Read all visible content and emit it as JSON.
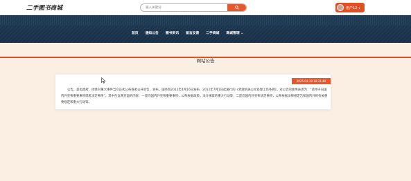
{
  "header": {
    "logo": "二手图书商城",
    "search": {
      "placeholder": "输入关键词"
    },
    "user": {
      "label": "用户12",
      "caret": "▾"
    }
  },
  "nav": {
    "items": [
      {
        "label": "首页"
      },
      {
        "label": "通知公告"
      },
      {
        "label": "图书资讯"
      },
      {
        "label": "留言反馈"
      },
      {
        "label": "二手商城"
      },
      {
        "label": "商城管理 ⌄"
      }
    ]
  },
  "page": {
    "title": "网站公告"
  },
  "notice": {
    "date": "2025-04-30 18:21:40",
    "text": "公告。是指政府、团体对重大事件当众正式公布或者公开宣告，宣布。国务院2012年4月16日发布、2012年7月1日起施行的《党政机关公文处理工作条例》，对公告的使用表述为：“适用于向国内外宣布重要事项或者法定事项”。其中包含两方面的内容：一是向国内外宣布重要事项，公布依据政策，法令采取的重大行动等；二是向国内外宣布法定事项，公布依据法律规定告知国内外的有关重要规定和重大行动等。"
  },
  "colors": {
    "accent": "#e5582d",
    "nav_bg": "#1f3a52",
    "page_bg": "#fbeee3"
  }
}
